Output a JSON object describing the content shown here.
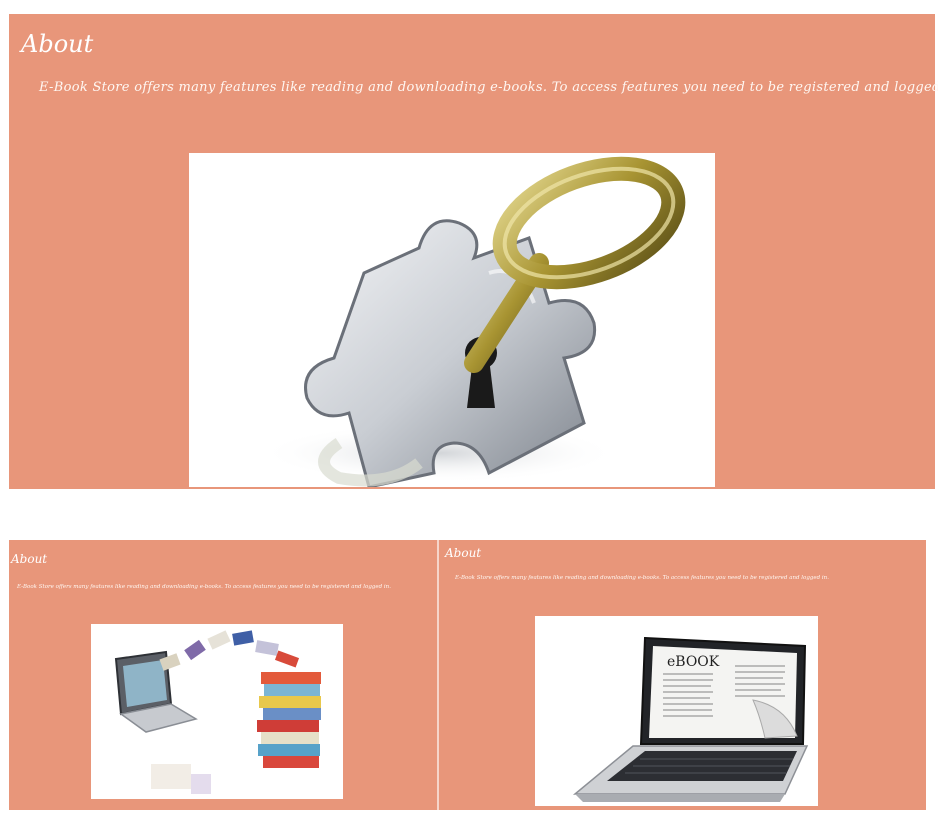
{
  "about_top": {
    "title": "About",
    "description": "E-Book Store offers many features like reading and downloading e-books. To access features you need to be registered and logged in.",
    "image_icon": "puzzle-key-icon"
  },
  "about_bottom_left": {
    "title": "About",
    "description": "E-Book Store offers many features like reading and downloading e-books. To access features you need to be registered and logged in.",
    "image_icon": "laptop-books-icon"
  },
  "about_bottom_right": {
    "title": "About",
    "description": "E-Book Store offers many features like reading and downloading e-books. To access features you need to be registered and logged in.",
    "image_icon": "laptop-ebook-icon",
    "ebook_label": "eBOOK"
  },
  "colors": {
    "panel_bg": "#e8967a",
    "text": "#ffffff"
  }
}
